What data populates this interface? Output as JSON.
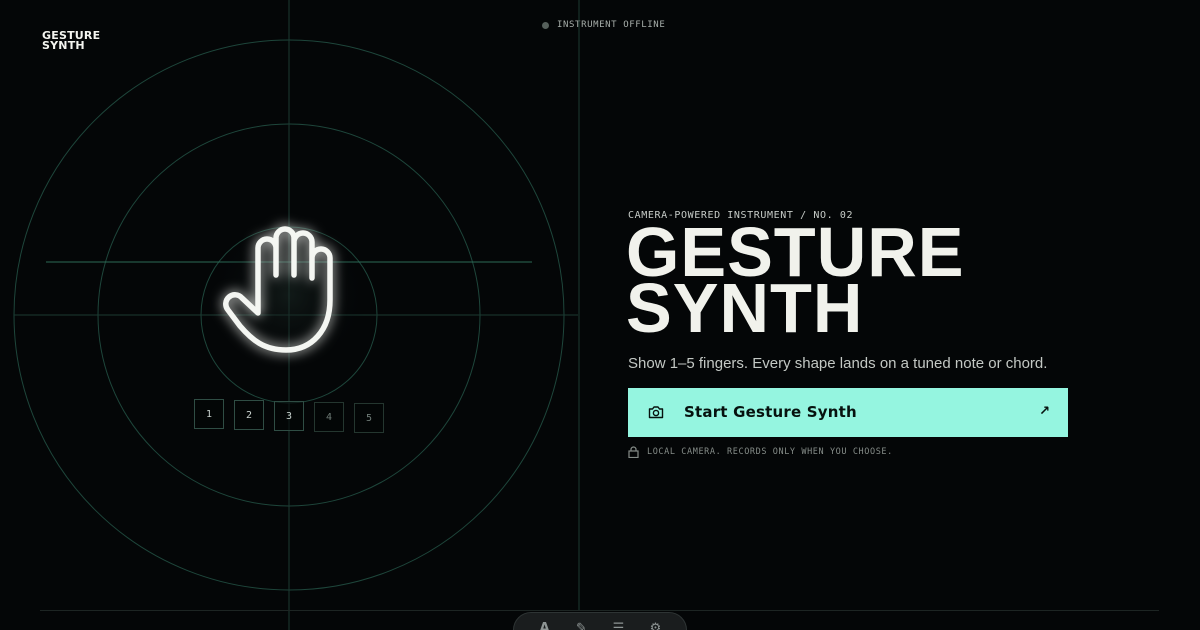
{
  "brand": {
    "logo_line1": "GESTURE",
    "logo_line2": "SYNTH"
  },
  "status": {
    "text": "INSTRUMENT OFFLINE",
    "dot_color": "#56605b"
  },
  "stage": {
    "icon": "hand-icon",
    "finger_counts": [
      "1",
      "2",
      "3",
      "4",
      "5"
    ]
  },
  "hero": {
    "eyebrow": "CAMERA-POWERED INSTRUMENT / NO. 02",
    "title_line1": "GESTURE",
    "title_line2": "SYNTH",
    "tagline": "Show 1–5 fingers. Every shape lands on a tuned note or chord.",
    "cta_label": "Start Gesture Synth",
    "cta_icon": "camera-icon",
    "cta_arrow": "↗",
    "privacy_note": "LOCAL CAMERA. RECORDS ONLY WHEN YOU CHOOSE.",
    "privacy_icon": "lock-icon"
  },
  "colors": {
    "background": "#040607",
    "accent": "#95f5e0",
    "grid": "#1f4a3e"
  },
  "dock": {
    "items": [
      {
        "icon": "text-tool-icon",
        "glyph": "A"
      },
      {
        "icon": "brush-icon",
        "glyph": "✎"
      },
      {
        "icon": "menu-icon",
        "glyph": "☰"
      },
      {
        "icon": "gear-icon",
        "glyph": "⚙"
      }
    ]
  }
}
